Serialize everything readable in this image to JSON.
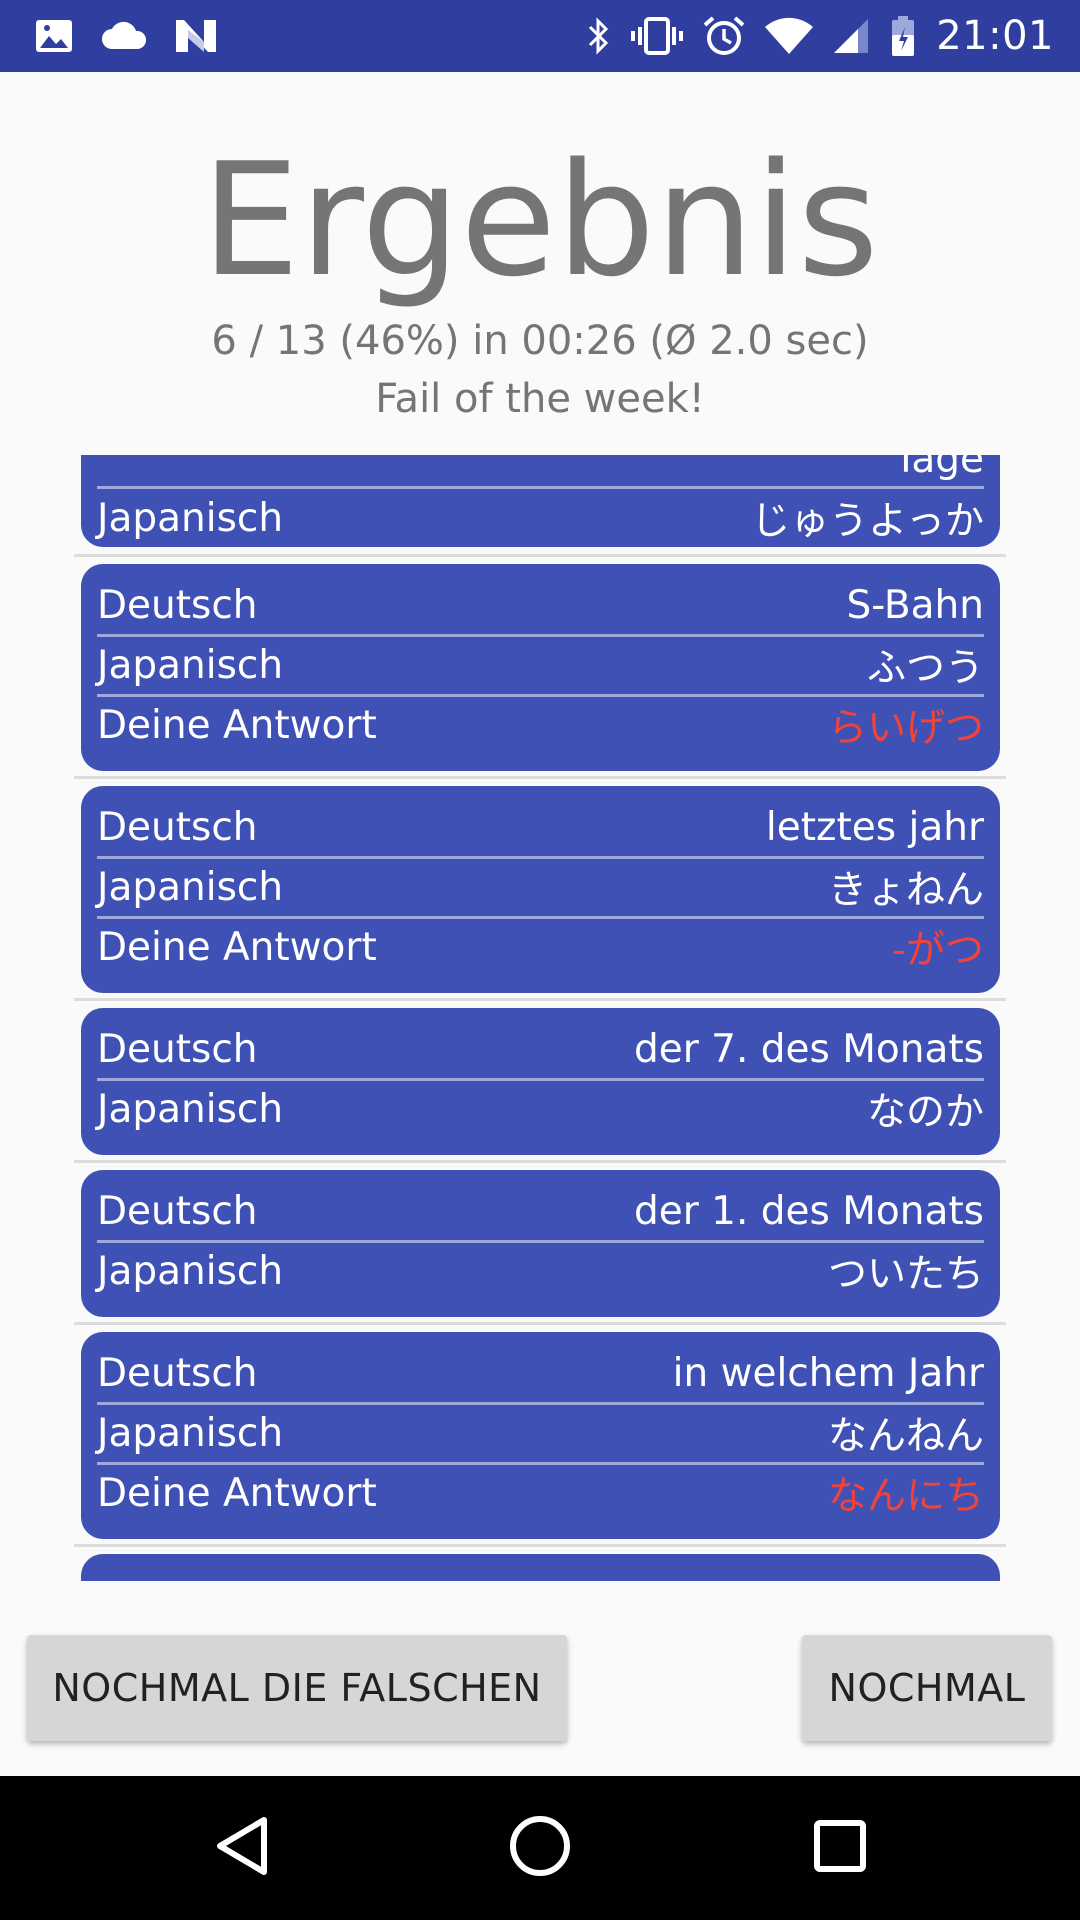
{
  "status_bar": {
    "time": "21:01",
    "left_icons": [
      "image-icon",
      "cloud-icon",
      "n-logo-icon"
    ],
    "right_icons": [
      "bluetooth-icon",
      "vibrate-icon",
      "alarm-icon",
      "wifi-icon",
      "signal-icon",
      "battery-icon"
    ],
    "background": "#303f9f"
  },
  "header": {
    "title": "Ergebnis",
    "stats": "6 / 13 (46%) in 00:26 (Ø 2.0 sec)",
    "verdict": "Fail of the week!"
  },
  "results": {
    "card_color": "#3f51b5",
    "wrong_answer_color": "#f44336",
    "partial_card": {
      "top_value": "Tage",
      "label_japanisch": "Japanisch",
      "value_japanisch": "じゅうよっか"
    },
    "cards": [
      {
        "rows": [
          {
            "label": "Deutsch",
            "value": "S-Bahn"
          },
          {
            "label": "Japanisch",
            "value": "ふつう"
          },
          {
            "label": "Deine Antwort",
            "value": "らいげつ"
          }
        ]
      },
      {
        "rows": [
          {
            "label": "Deutsch",
            "value": "letztes jahr"
          },
          {
            "label": "Japanisch",
            "value": "きょねん"
          },
          {
            "label": "Deine Antwort",
            "value": "-がつ"
          }
        ]
      },
      {
        "rows": [
          {
            "label": "Deutsch",
            "value": "der 7. des Monats"
          },
          {
            "label": "Japanisch",
            "value": "なのか"
          }
        ]
      },
      {
        "rows": [
          {
            "label": "Deutsch",
            "value": "der 1. des Monats"
          },
          {
            "label": "Japanisch",
            "value": "ついたち"
          }
        ]
      },
      {
        "rows": [
          {
            "label": "Deutsch",
            "value": "in welchem Jahr"
          },
          {
            "label": "Japanisch",
            "value": "なんねん"
          },
          {
            "label": "Deine Antwort",
            "value": "なんにち"
          }
        ]
      }
    ]
  },
  "buttons": {
    "retry_wrong": "NOCHMAL DIE FALSCHEN",
    "retry": "NOCHMAL"
  },
  "nav_bar": {
    "icons": [
      "back-icon",
      "home-icon",
      "recents-icon"
    ]
  }
}
